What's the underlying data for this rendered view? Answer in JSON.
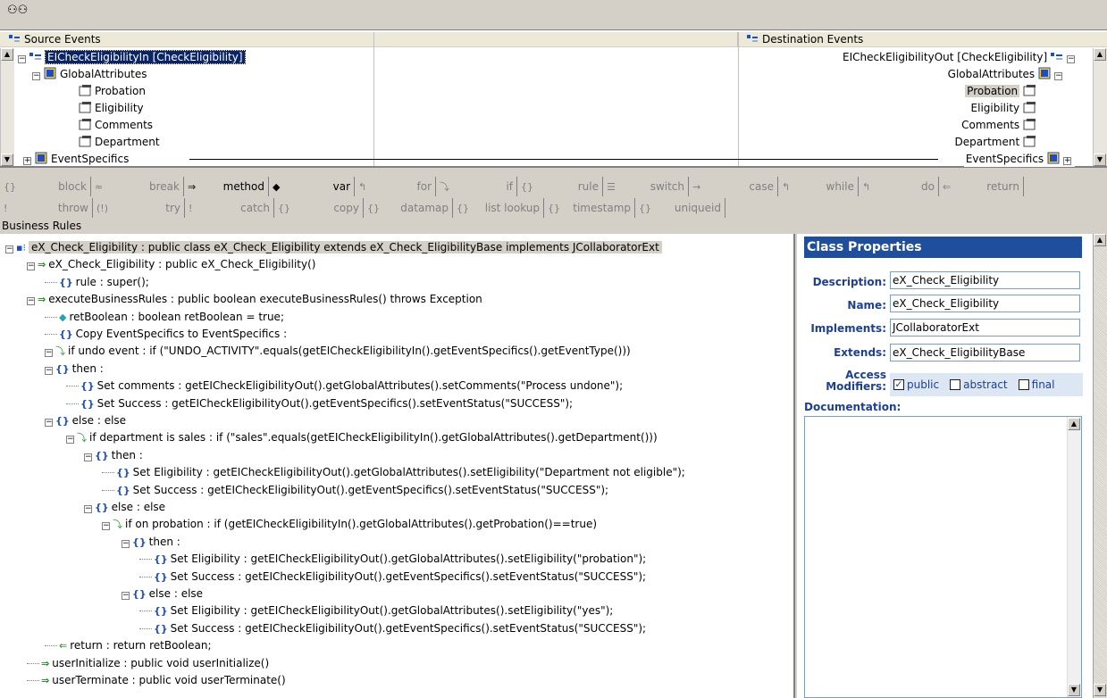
{
  "mapper": {
    "source_title": "Source Events",
    "dest_title": "Destination Events",
    "source_tree": [
      {
        "label": "EICheckEligibilityIn [CheckEligibility]",
        "selected": true
      },
      {
        "label": "GlobalAttributes"
      },
      {
        "label": "Probation"
      },
      {
        "label": "Eligibility"
      },
      {
        "label": "Comments"
      },
      {
        "label": "Department"
      },
      {
        "label": "EventSpecifics"
      }
    ],
    "dest_tree": [
      {
        "label": "EICheckEligibilityOut [CheckEligibility]"
      },
      {
        "label": "GlobalAttributes"
      },
      {
        "label": "Probation",
        "highlight": true
      },
      {
        "label": "Eligibility"
      },
      {
        "label": "Comments"
      },
      {
        "label": "Department"
      },
      {
        "label": "EventSpecifics"
      }
    ]
  },
  "toolbar": {
    "row1": [
      {
        "icon": "{}",
        "label": "block",
        "enabled": false
      },
      {
        "icon": "≈",
        "label": "break",
        "enabled": false
      },
      {
        "icon": "⇒",
        "label": "method",
        "enabled": true
      },
      {
        "icon": "◆",
        "label": "var",
        "enabled": true
      },
      {
        "icon": "↰",
        "label": "for",
        "enabled": false
      },
      {
        "icon": "⤵",
        "label": "if",
        "enabled": false
      },
      {
        "icon": "{}",
        "label": "rule",
        "enabled": false
      },
      {
        "icon": "☰",
        "label": "switch",
        "enabled": false
      },
      {
        "icon": "→",
        "label": "case",
        "enabled": false
      },
      {
        "icon": "↰",
        "label": "while",
        "enabled": false
      },
      {
        "icon": "↰",
        "label": "do",
        "enabled": false
      },
      {
        "icon": "⇐",
        "label": "return",
        "enabled": false
      }
    ],
    "row2": [
      {
        "icon": "!",
        "label": "throw",
        "enabled": false
      },
      {
        "icon": "(!)",
        "label": "try",
        "enabled": false
      },
      {
        "icon": "!",
        "label": "catch",
        "enabled": false
      },
      {
        "icon": "{}",
        "label": "copy",
        "enabled": false
      },
      {
        "icon": "{}",
        "label": "datamap",
        "enabled": false
      },
      {
        "icon": "{}",
        "label": "list lookup",
        "enabled": false
      },
      {
        "icon": "{}",
        "label": "timestamp",
        "enabled": false
      },
      {
        "icon": "{}",
        "label": "uniqueid",
        "enabled": false
      }
    ]
  },
  "business_rules": {
    "title": "Business Rules",
    "lines": [
      {
        "indent": 0,
        "type": "class",
        "text": "eX_Check_Eligibility : public class eX_Check_Eligibility extends eX_Check_EligibilityBase implements JCollaboratorExt"
      },
      {
        "indent": 1,
        "type": "method",
        "text": "eX_Check_Eligibility : public  eX_Check_Eligibility()"
      },
      {
        "indent": 2,
        "type": "block",
        "text": "rule : super();"
      },
      {
        "indent": 1,
        "type": "method",
        "text": "executeBusinessRules : public boolean executeBusinessRules() throws Exception"
      },
      {
        "indent": 2,
        "type": "var",
        "text": "retBoolean : boolean retBoolean = true;"
      },
      {
        "indent": 2,
        "type": "block",
        "text": "Copy EventSpecifics to EventSpecifics :"
      },
      {
        "indent": 2,
        "type": "if",
        "text": "if undo event : if (\"UNDO_ACTIVITY\".equals(getEICheckEligibilityIn().getEventSpecifics().getEventType()))"
      },
      {
        "indent": 3,
        "type": "block",
        "text": "then :"
      },
      {
        "indent": 4,
        "type": "block",
        "text": "Set comments : getEICheckEligibilityOut().getGlobalAttributes().setComments(\"Process undone\");"
      },
      {
        "indent": 4,
        "type": "block",
        "text": "Set Success : getEICheckEligibilityOut().getEventSpecifics().setEventStatus(\"SUCCESS\");"
      },
      {
        "indent": 3,
        "type": "block",
        "text": "else : else"
      },
      {
        "indent": 4,
        "type": "if",
        "text": "if department is sales : if (\"sales\".equals(getEICheckEligibilityIn().getGlobalAttributes().getDepartment()))"
      },
      {
        "indent": 5,
        "type": "block",
        "text": "then :"
      },
      {
        "indent": 6,
        "type": "block",
        "text": "Set Eligibility : getEICheckEligibilityOut().getGlobalAttributes().setEligibility(\"Department not eligible\");"
      },
      {
        "indent": 6,
        "type": "block",
        "text": "Set Success : getEICheckEligibilityOut().getEventSpecifics().setEventStatus(\"SUCCESS\");"
      },
      {
        "indent": 5,
        "type": "block",
        "text": "else : else"
      },
      {
        "indent": 6,
        "type": "if",
        "text": "if on probation : if (getEICheckEligibilityIn().getGlobalAttributes().getProbation()==true)"
      },
      {
        "indent": 7,
        "type": "block",
        "text": "then :"
      },
      {
        "indent": 8,
        "type": "block",
        "text": "Set Eligibility : getEICheckEligibilityOut().getGlobalAttributes().setEligibility(\"probation\");"
      },
      {
        "indent": 8,
        "type": "block",
        "text": "Set Success : getEICheckEligibilityOut().getEventSpecifics().setEventStatus(\"SUCCESS\");"
      },
      {
        "indent": 7,
        "type": "block",
        "text": "else : else"
      },
      {
        "indent": 8,
        "type": "block",
        "text": "Set Eligibility : getEICheckEligibilityOut().getGlobalAttributes().setEligibility(\"yes\");"
      },
      {
        "indent": 8,
        "type": "block",
        "text": "Set Success : getEICheckEligibilityOut().getEventSpecifics().setEventStatus(\"SUCCESS\");"
      },
      {
        "indent": 2,
        "type": "return",
        "text": "return : return retBoolean;"
      },
      {
        "indent": 1,
        "type": "method",
        "text": "userInitialize : public void userInitialize()"
      },
      {
        "indent": 1,
        "type": "method",
        "text": "userTerminate : public void userTerminate()"
      }
    ]
  },
  "class_properties": {
    "title": "Class Properties",
    "description_label": "Description:",
    "description": "eX_Check_Eligibility",
    "name_label": "Name:",
    "name": "eX_Check_Eligibility",
    "implements_label": "Implements:",
    "implements": "JCollaboratorExt",
    "extends_label": "Extends:",
    "extends": "eX_Check_EligibilityBase",
    "access_label_1": "Access",
    "access_label_2": "Modifiers:",
    "modifiers": [
      {
        "label": "public",
        "checked": true
      },
      {
        "label": "abstract",
        "checked": false
      },
      {
        "label": "final",
        "checked": false
      }
    ],
    "documentation_label": "Documentation:"
  },
  "colors": {
    "selection": "#0a246a",
    "panel_title": "#1f4f9c",
    "label_blue": "#1f3f8f"
  }
}
